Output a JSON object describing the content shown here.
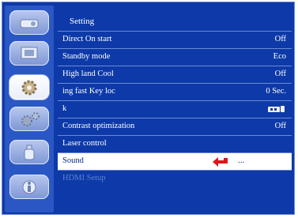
{
  "menu": {
    "title": "Setting",
    "items": [
      {
        "label": "Direct On start",
        "value": "Off"
      },
      {
        "label": "Standby mode",
        "value": "Eco"
      },
      {
        "label": "High land  Cool",
        "value": "Off"
      },
      {
        "label": "ing fast  Key loc",
        "value": "0 Sec."
      },
      {
        "label": "k",
        "value": ""
      },
      {
        "label": "Contrast optimization",
        "value": "Off"
      },
      {
        "label": "Laser control",
        "value": ""
      },
      {
        "label": "Sound",
        "value": "...",
        "selected": true
      },
      {
        "label": "HDMI Setup",
        "value": "",
        "disabled": true
      }
    ]
  },
  "sidebar_icons": [
    "projector-icon",
    "screen-icon",
    "gear-icon",
    "gears-icon",
    "bottle-icon",
    "info-icon"
  ],
  "colors": {
    "background": "#0d3aa8",
    "highlight": "#ffffff",
    "arrow": "#e0141b",
    "disabled_text": "#5f80cf"
  }
}
